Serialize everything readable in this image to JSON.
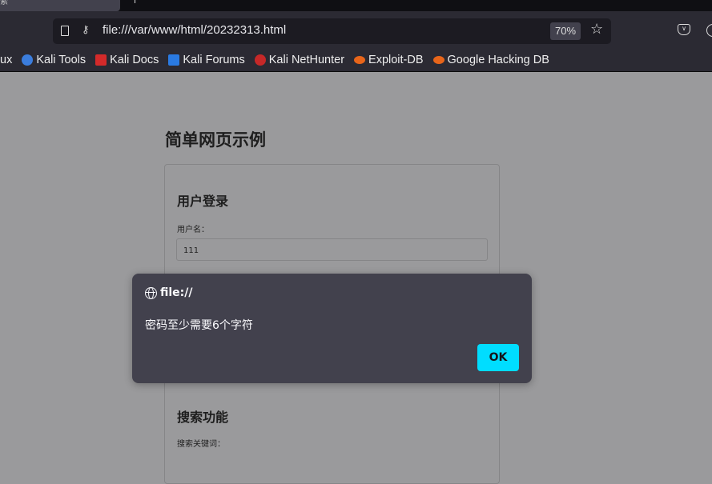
{
  "browser": {
    "tab_label": "索",
    "url": "file:///var/www/html/20232313.html",
    "zoom": "70%",
    "bookmarks": [
      {
        "label": "ux",
        "color": ""
      },
      {
        "label": "Kali Tools",
        "color": "#3b7ddd"
      },
      {
        "label": "Kali Docs",
        "color": "#d42a2a"
      },
      {
        "label": "Kali Forums",
        "color": "#2a7ae2"
      },
      {
        "label": "Kali NetHunter",
        "color": "#c62828"
      },
      {
        "label": "Exploit-DB",
        "color": "#e8651a"
      },
      {
        "label": "Google Hacking DB",
        "color": "#e8651a"
      }
    ]
  },
  "page": {
    "title": "简单网页示例",
    "login": {
      "heading": "用户登录",
      "username_label": "用户名：",
      "username_value": "111"
    },
    "search": {
      "heading": "搜索功能",
      "keyword_label": "搜索关键词："
    }
  },
  "dialog": {
    "origin": "file://",
    "message": "密码至少需要6个字符",
    "ok_label": "OK"
  },
  "colors": {
    "accent": "#00ddff",
    "dialog_bg": "#42414d"
  }
}
